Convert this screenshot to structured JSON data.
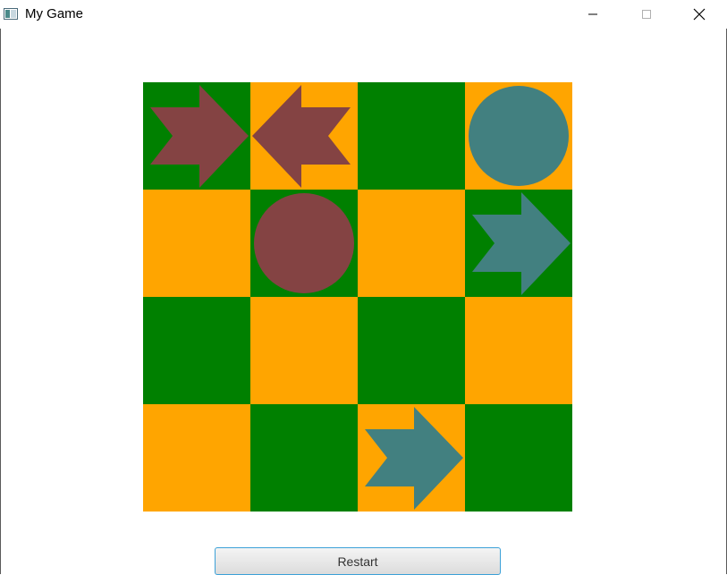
{
  "window": {
    "title": "My Game",
    "icon": "app-window-icon",
    "controls": [
      "minimize-icon",
      "maximize-icon",
      "close-icon"
    ]
  },
  "colors": {
    "green": "#008000",
    "orange": "#ffa500",
    "red_piece": "#844343",
    "teal_piece": "#428080",
    "window_border": "#5a5a5a"
  },
  "board": {
    "rows": 4,
    "cols": 4,
    "cells": [
      [
        {
          "color": "green",
          "piece": {
            "shape": "arrow",
            "dir": "right",
            "owner": "red"
          }
        },
        {
          "color": "orange",
          "piece": {
            "shape": "arrow",
            "dir": "left",
            "owner": "red"
          }
        },
        {
          "color": "green",
          "piece": null
        },
        {
          "color": "orange",
          "piece": {
            "shape": "circle",
            "owner": "teal"
          }
        }
      ],
      [
        {
          "color": "orange",
          "piece": null
        },
        {
          "color": "green",
          "piece": {
            "shape": "circle",
            "owner": "red"
          }
        },
        {
          "color": "orange",
          "piece": null
        },
        {
          "color": "green",
          "piece": {
            "shape": "arrow",
            "dir": "right",
            "owner": "teal"
          }
        }
      ],
      [
        {
          "color": "green",
          "piece": null
        },
        {
          "color": "orange",
          "piece": null
        },
        {
          "color": "green",
          "piece": null
        },
        {
          "color": "orange",
          "piece": null
        }
      ],
      [
        {
          "color": "orange",
          "piece": null
        },
        {
          "color": "green",
          "piece": null
        },
        {
          "color": "orange",
          "piece": {
            "shape": "arrow",
            "dir": "right",
            "owner": "teal"
          }
        },
        {
          "color": "green",
          "piece": null
        }
      ]
    ]
  },
  "restart_label": "Restart"
}
